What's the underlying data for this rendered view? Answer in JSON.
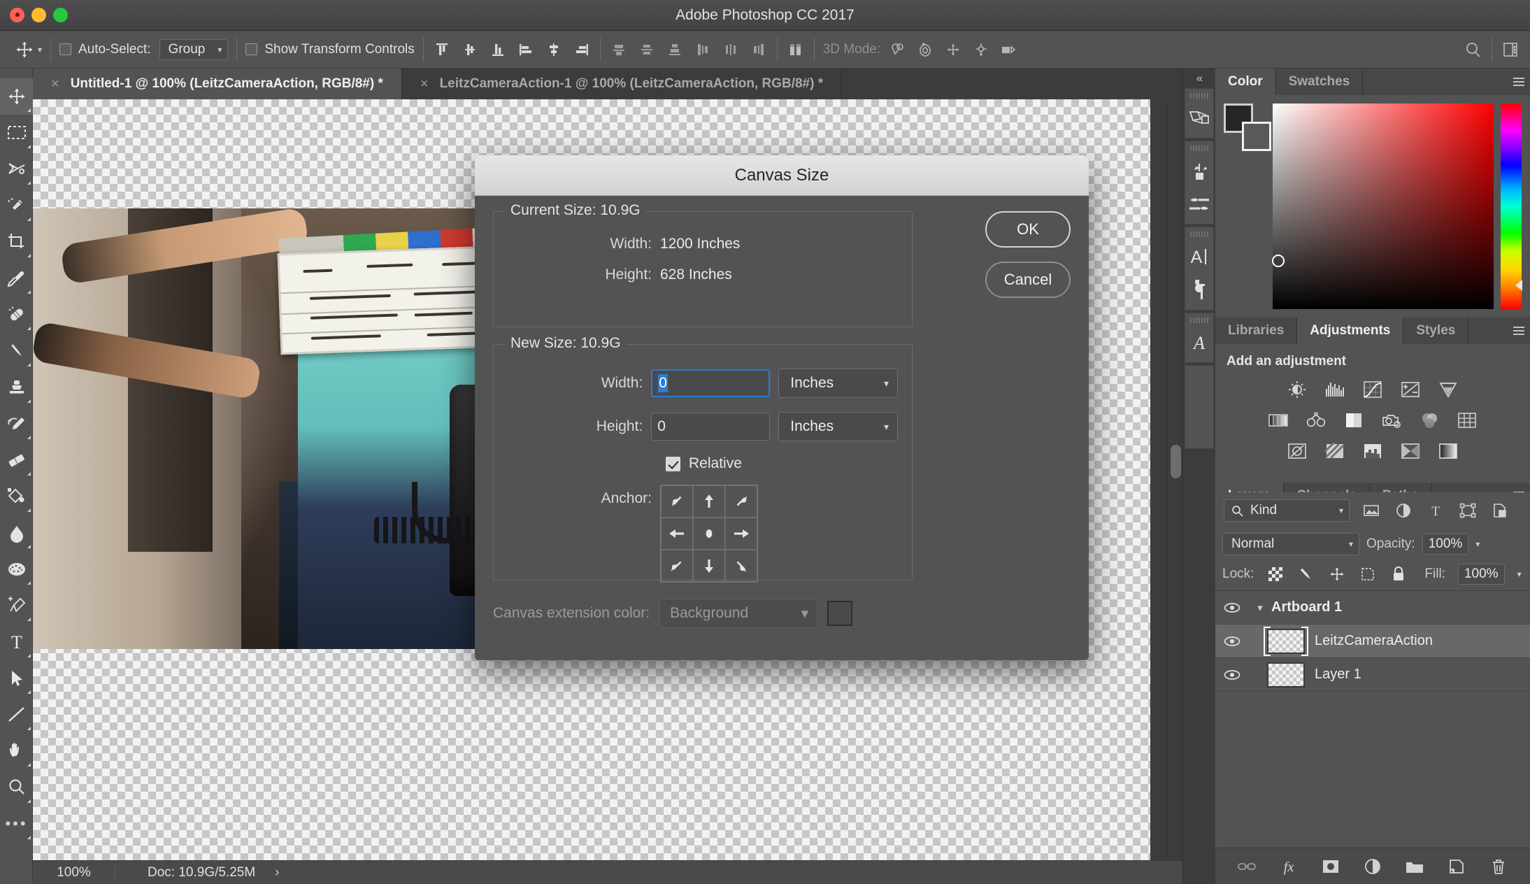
{
  "window": {
    "app_title": "Adobe Photoshop CC 2017",
    "traffic_lights": [
      "close",
      "minimize",
      "zoom"
    ]
  },
  "options_bar": {
    "tool_icon": "move-tool-icon",
    "tool_preset_chevron": "chevron-down-icon",
    "auto_select": {
      "label": "Auto-Select:",
      "checked": false,
      "value": "Group"
    },
    "show_transform_controls": {
      "label": "Show Transform Controls",
      "checked": false
    },
    "align_icons": [
      "align-top-edges-icon",
      "align-vertical-centers-icon",
      "align-bottom-edges-icon",
      "align-left-edges-icon",
      "align-horizontal-centers-icon",
      "align-right-edges-icon"
    ],
    "distribute_icons": [
      "distribute-top-edges-icon",
      "distribute-vertical-centers-icon",
      "distribute-bottom-edges-icon",
      "distribute-left-edges-icon",
      "distribute-horizontal-centers-icon",
      "distribute-right-edges-icon"
    ],
    "auto_align_icon": "auto-align-layers-icon",
    "mode3d": {
      "label": "3D Mode:",
      "icons": [
        "3d-rotate-icon",
        "3d-roll-icon",
        "3d-pan-icon",
        "3d-slide-icon",
        "3d-scale-icon"
      ]
    },
    "search_icon": "search-icon",
    "workspace_icon": "workspace-switcher-icon"
  },
  "toolbar": {
    "tools": [
      {
        "name": "move-tool",
        "active": true
      },
      {
        "name": "rectangular-marquee-tool",
        "active": false
      },
      {
        "name": "lasso-tool",
        "active": false
      },
      {
        "name": "quick-selection-tool",
        "active": false
      },
      {
        "name": "crop-tool",
        "active": false
      },
      {
        "name": "eyedropper-tool",
        "active": false
      },
      {
        "name": "spot-healing-brush-tool",
        "active": false
      },
      {
        "name": "brush-tool",
        "active": false
      },
      {
        "name": "clone-stamp-tool",
        "active": false
      },
      {
        "name": "history-brush-tool",
        "active": false
      },
      {
        "name": "eraser-tool",
        "active": false
      },
      {
        "name": "gradient-tool",
        "active": false
      },
      {
        "name": "blur-tool",
        "active": false
      },
      {
        "name": "dodge-tool",
        "active": false
      },
      {
        "name": "pen-tool",
        "active": false
      },
      {
        "name": "type-tool",
        "active": false
      },
      {
        "name": "path-selection-tool",
        "active": false
      },
      {
        "name": "line-shape-tool",
        "active": false
      },
      {
        "name": "hand-tool",
        "active": false
      },
      {
        "name": "zoom-tool",
        "active": false
      },
      {
        "name": "edit-toolbar-tool",
        "active": false
      }
    ]
  },
  "document_tabs": [
    {
      "label": "Untitled-1 @ 100% (LeitzCameraAction, RGB/8#) *",
      "active": true,
      "close": "×"
    },
    {
      "label": "LeitzCameraAction-1 @ 100% (LeitzCameraAction, RGB/8#) *",
      "active": false,
      "close": "×"
    }
  ],
  "status_bar": {
    "zoom": "100%",
    "doc": "Doc: 10.9G/5.25M",
    "arrow": "›"
  },
  "rail": {
    "collapse": "«",
    "groups": [
      {
        "icons": [
          "3d-panel-icon"
        ]
      },
      {
        "icons": [
          "brush-presets-icon",
          "brush-settings-icon"
        ]
      },
      {
        "icons": [
          "character-panel-icon",
          "paragraph-panel-icon"
        ]
      },
      {
        "icons": [
          "glyphs-panel-icon"
        ]
      }
    ]
  },
  "color_panel": {
    "tabs": [
      {
        "label": "Color",
        "active": true
      },
      {
        "label": "Swatches",
        "active": false
      }
    ],
    "menu_icon": "panel-menu-icon",
    "foreground_color": "#262626",
    "background_color": "#595959",
    "field_icon": "color-field",
    "hue_icon": "hue-slider"
  },
  "adjustments_panel": {
    "tabs": [
      {
        "label": "Libraries",
        "active": false
      },
      {
        "label": "Adjustments",
        "active": true
      },
      {
        "label": "Styles",
        "active": false
      }
    ],
    "menu_icon": "panel-menu-icon",
    "title": "Add an adjustment",
    "rows": [
      [
        "brightness-contrast-icon",
        "levels-icon",
        "curves-icon",
        "exposure-icon",
        "vibrance-icon"
      ],
      [
        "hue-saturation-icon",
        "color-balance-icon",
        "black-white-icon",
        "photo-filter-icon",
        "channel-mixer-icon",
        "color-lookup-icon"
      ],
      [
        "invert-icon",
        "posterize-icon",
        "threshold-icon",
        "gradient-map-icon",
        "selective-color-icon"
      ]
    ]
  },
  "layers_panel": {
    "tabs": [
      {
        "label": "Layers",
        "active": true
      },
      {
        "label": "Channels",
        "active": false
      },
      {
        "label": "Paths",
        "active": false
      }
    ],
    "menu_icon": "panel-menu-icon",
    "filter": {
      "search_icon": "search-icon",
      "kind_label": "Kind",
      "chevron": "chevron-down-icon",
      "type_icons": [
        "filter-pixel-icon",
        "filter-adjustment-icon",
        "filter-type-icon",
        "filter-shape-icon",
        "filter-smart-object-icon"
      ],
      "toggle_icon": "filter-toggle-icon"
    },
    "blend_mode": "Normal",
    "opacity_label": "Opacity:",
    "opacity_value": "100%",
    "lock_label": "Lock:",
    "lock_icons": [
      "lock-transparent-pixels-icon",
      "lock-image-pixels-icon",
      "lock-position-icon",
      "lock-artboard-nesting-icon",
      "lock-all-icon"
    ],
    "fill_label": "Fill:",
    "fill_value": "100%",
    "layers": [
      {
        "name": "Artboard 1",
        "type": "group",
        "visible": true,
        "selected": false,
        "expand": "chevron-down-icon",
        "thumb": false
      },
      {
        "name": "LeitzCameraAction",
        "type": "layer",
        "visible": true,
        "selected": true,
        "thumb": true,
        "bracketed": true
      },
      {
        "name": "Layer 1",
        "type": "layer",
        "visible": true,
        "selected": false,
        "thumb": true,
        "bracketed": false
      }
    ],
    "footer_icons": [
      "link-layers-icon",
      "layer-style-fx-icon",
      "add-layer-mask-icon",
      "new-fill-adjustment-icon",
      "new-group-icon",
      "new-layer-icon",
      "delete-layer-icon"
    ]
  },
  "dialog": {
    "title": "Canvas Size",
    "current_size": {
      "legend": "Current Size: 10.9G",
      "width_label": "Width:",
      "width_value": "1200 Inches",
      "height_label": "Height:",
      "height_value": "628 Inches"
    },
    "new_size": {
      "legend": "New Size: 10.9G",
      "width_label": "Width:",
      "width_value": "0",
      "width_unit": "Inches",
      "width_focused": true,
      "height_label": "Height:",
      "height_value": "0",
      "height_unit": "Inches",
      "relative_label": "Relative",
      "relative_checked": true,
      "anchor_label": "Anchor:",
      "anchor_cells": [
        "arrow-up-left-icon",
        "arrow-up-icon",
        "arrow-up-right-icon",
        "arrow-left-icon",
        "anchor-center-dot-icon",
        "arrow-right-icon",
        "arrow-down-left-icon",
        "arrow-down-icon",
        "arrow-down-right-icon"
      ],
      "anchor_selected_index": 4
    },
    "canvas_extension": {
      "label": "Canvas extension color:",
      "value": "Background",
      "chevron": "chevron-down-icon",
      "swatch_color": "#4a4a4a",
      "disabled": true
    },
    "buttons": [
      {
        "label": "OK",
        "primary": true
      },
      {
        "label": "Cancel",
        "primary": false
      }
    ]
  },
  "colors": {
    "panel_bg": "#535353",
    "panel_dark": "#3c3c3c",
    "accent_blue": "#2e7cd6",
    "text": "#e0e0e0",
    "text_dim": "#9a9a9a"
  }
}
